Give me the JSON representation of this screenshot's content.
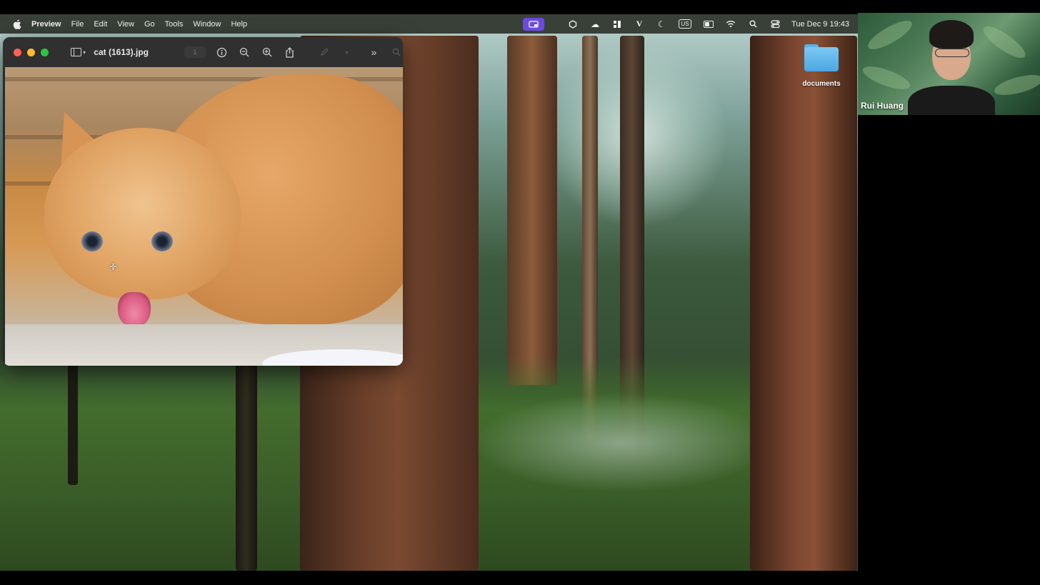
{
  "menubar": {
    "app_name": "Preview",
    "menus": [
      "File",
      "Edit",
      "View",
      "Go",
      "Tools",
      "Window",
      "Help"
    ],
    "input_source": "US",
    "datetime": "Tue Dec 9  19:43",
    "accent_color": "#6b4ae0"
  },
  "desktop": {
    "folder_label": "documents"
  },
  "preview_window": {
    "title": "cat (1613).jpg",
    "page_field": "1"
  },
  "webcam": {
    "participant_name": "Rui Huang"
  }
}
